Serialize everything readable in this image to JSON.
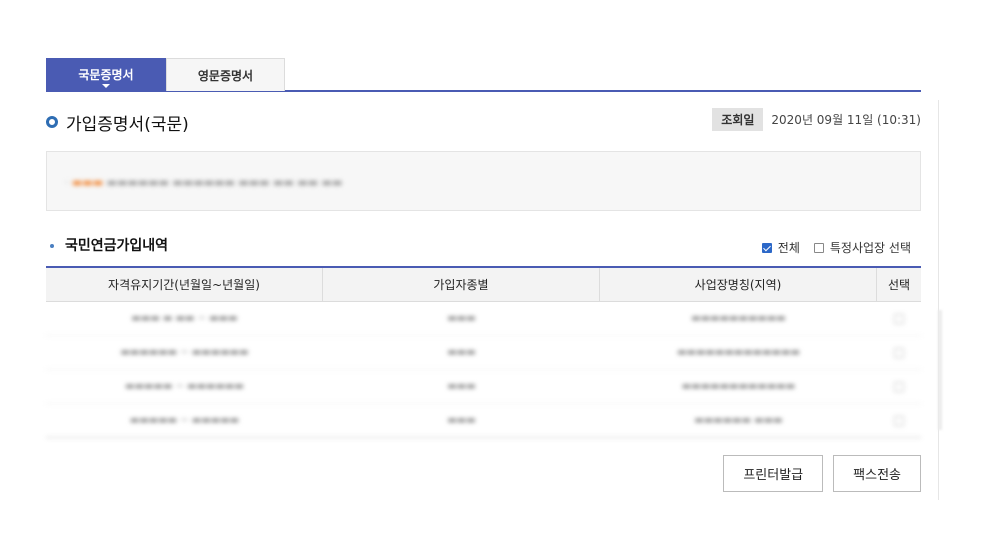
{
  "tabs": [
    {
      "label": "국문증명서",
      "active": true
    },
    {
      "label": "영문증명서",
      "active": false
    }
  ],
  "title": "가입증명서(국문)",
  "date": {
    "badge": "조회일",
    "value": "2020년 09월 11일 (10:31)"
  },
  "section": {
    "title": "국민연금가입내역",
    "check_all_label": "전체",
    "check_all_checked": true,
    "check_specific_label": "특정사업장 선택",
    "check_specific_checked": false
  },
  "table": {
    "headers": [
      "자격유지기간(년월일~년월일)",
      "가입자종별",
      "사업장명칭(지역)",
      "선택"
    ]
  },
  "buttons": {
    "print": "프린터발급",
    "fax": "팩스전송"
  },
  "colors": {
    "accent": "#4a5bb3",
    "ring": "#2e6db3",
    "checkbox": "#2c68c8"
  }
}
